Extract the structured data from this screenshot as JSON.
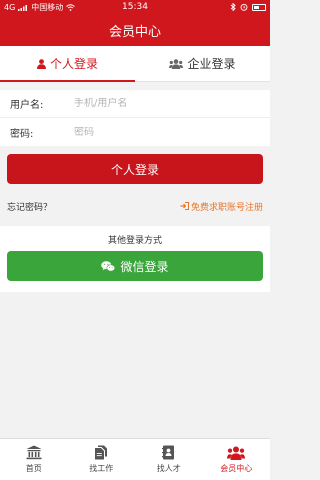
{
  "statusbar": {
    "carrier": "中国移动",
    "signal_label": "4G",
    "time": "15:34"
  },
  "header": {
    "title": "会员中心"
  },
  "tabs": [
    {
      "label": "个人登录",
      "icon": "user-icon",
      "active": true
    },
    {
      "label": "企业登录",
      "icon": "users-icon",
      "active": false
    }
  ],
  "form": {
    "username_label": "用户名:",
    "username_placeholder": "手机/用户名",
    "password_label": "密码:",
    "password_placeholder": "密码"
  },
  "login_button": "个人登录",
  "links": {
    "forgot": "忘记密码？",
    "register": "免费求职账号注册"
  },
  "other": {
    "title": "其他登录方式",
    "wechat_button": "微信登录"
  },
  "bottom_nav": [
    {
      "label": "首页",
      "icon": "bank-icon",
      "active": false
    },
    {
      "label": "找工作",
      "icon": "files-icon",
      "active": false
    },
    {
      "label": "找人才",
      "icon": "contact-book-icon",
      "active": false
    },
    {
      "label": "会员中心",
      "icon": "users-icon",
      "active": true
    }
  ],
  "colors": {
    "primary": "#d0171e",
    "wechat": "#3aa53a",
    "link_orange": "#e8762c"
  }
}
